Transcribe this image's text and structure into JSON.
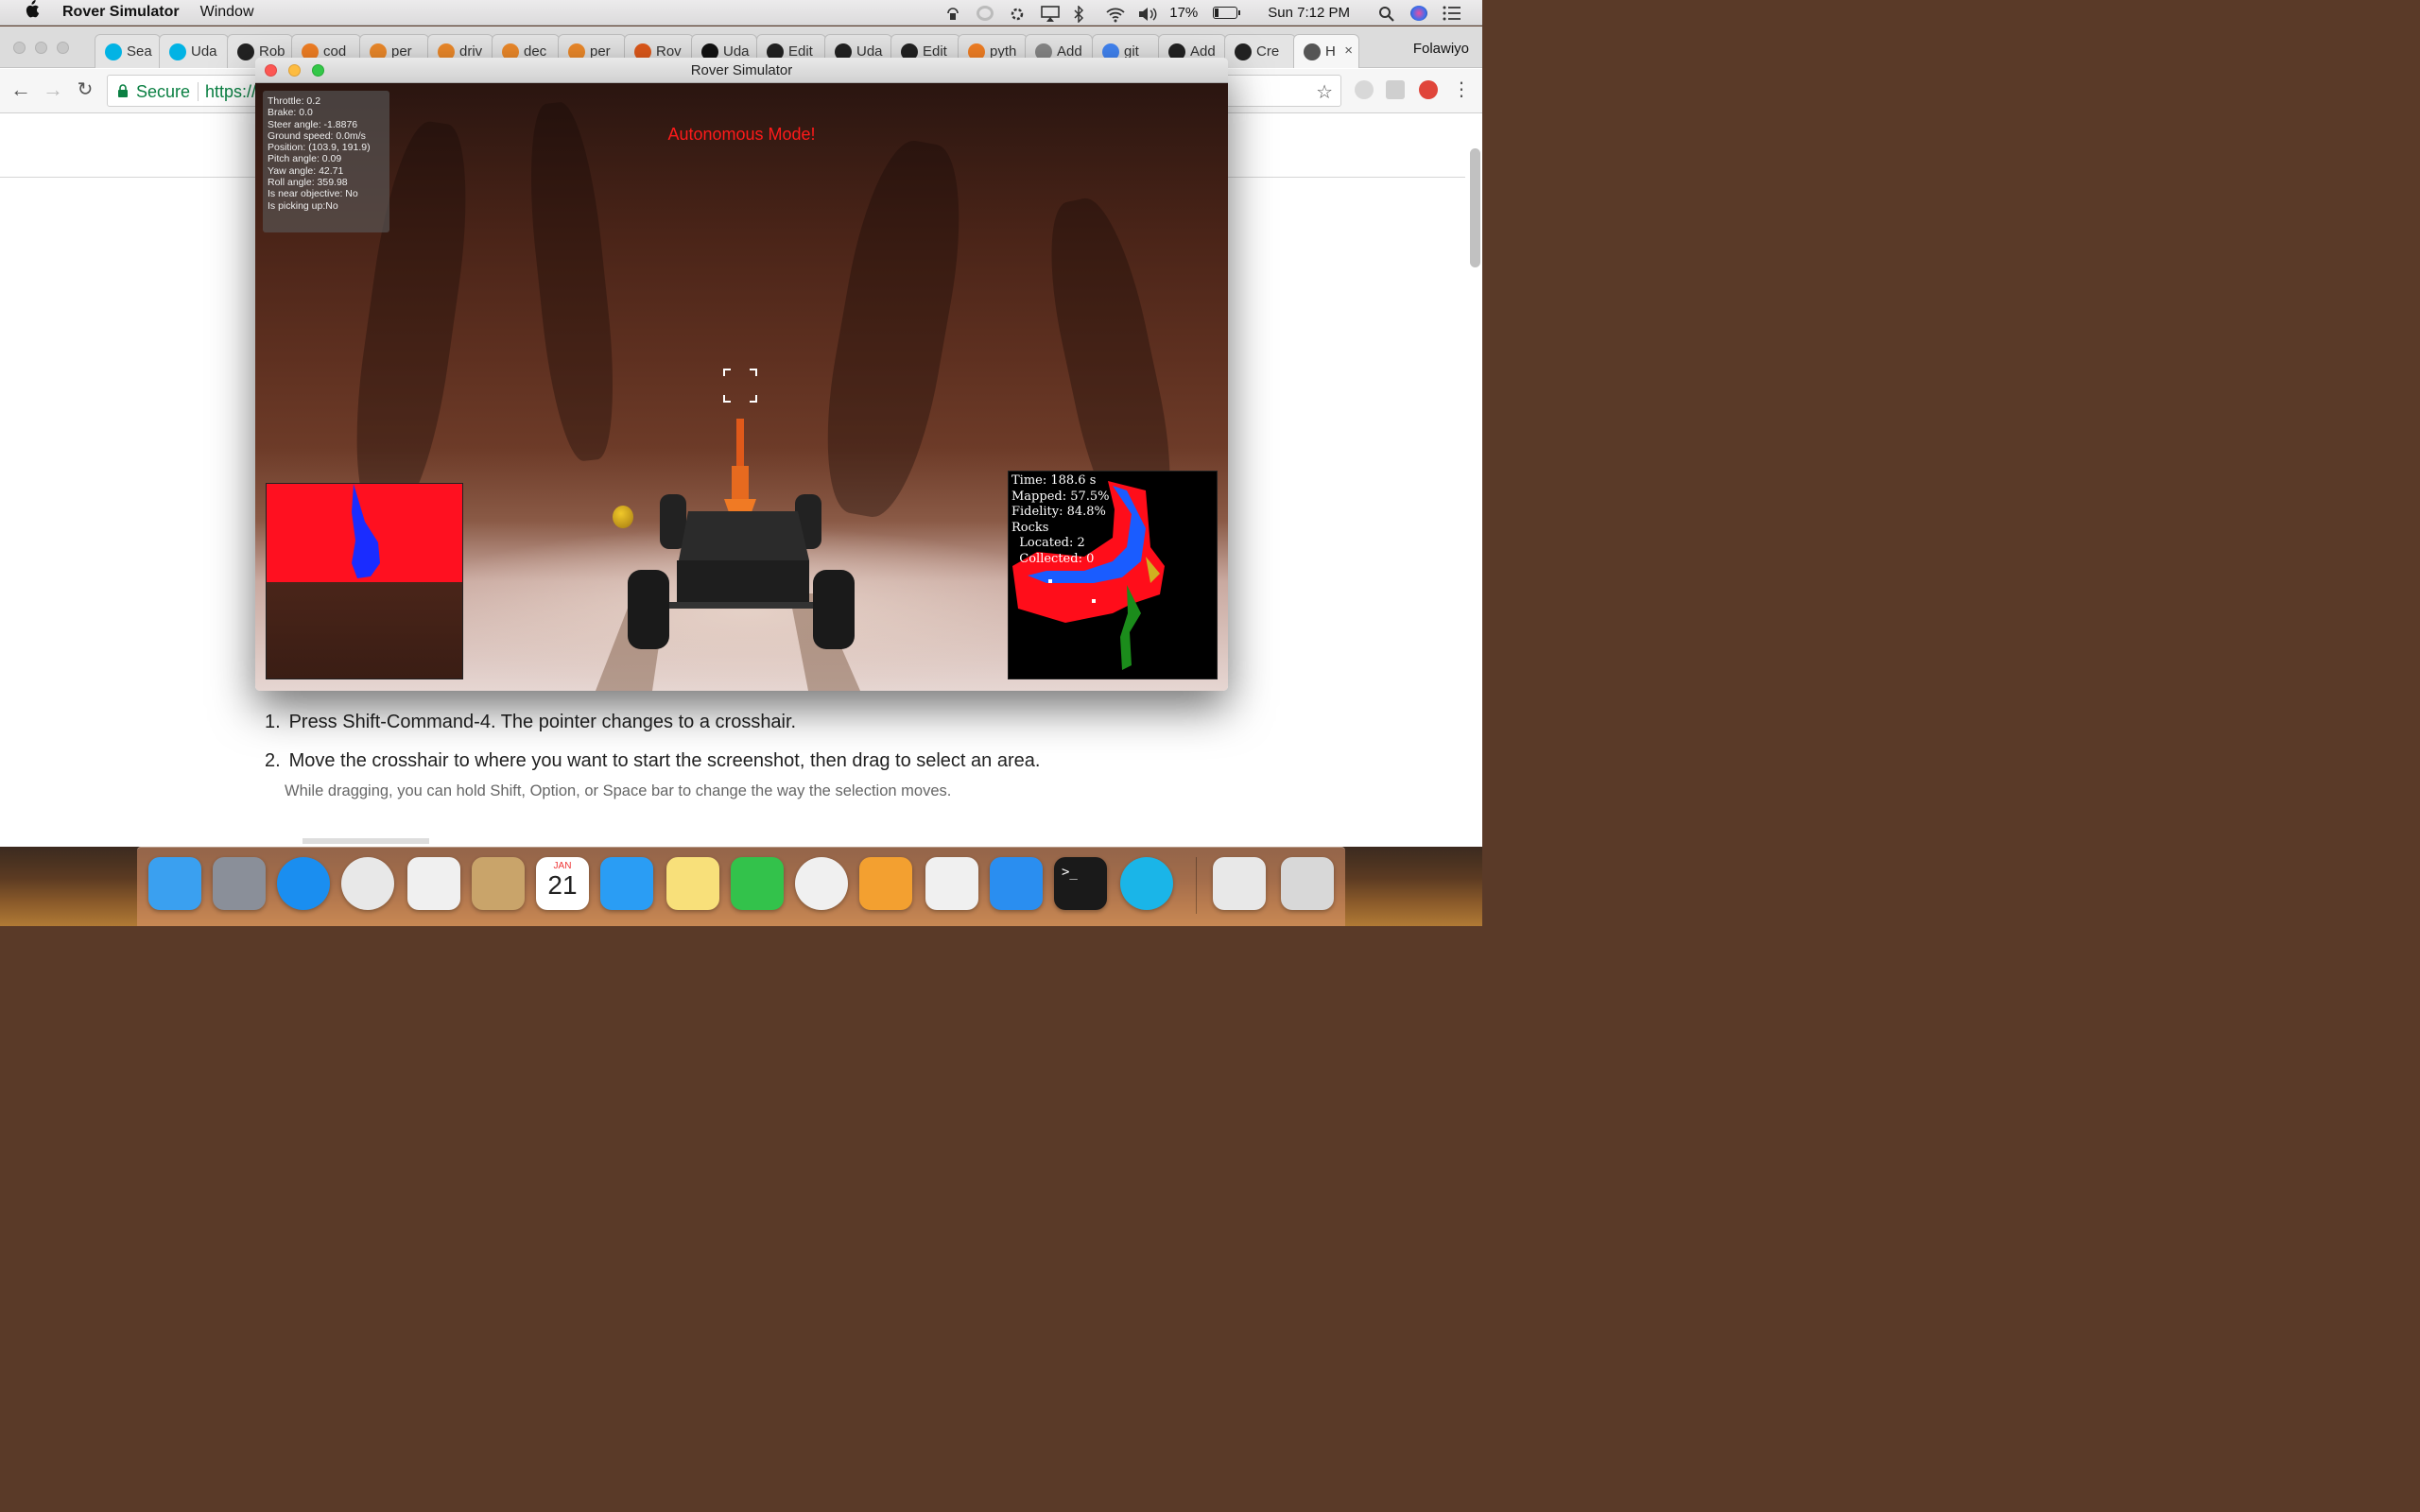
{
  "menubar": {
    "app_name": "Rover Simulator",
    "menus": [
      "Window"
    ],
    "battery": "17%",
    "clock": "Sun 7:12 PM"
  },
  "browser": {
    "tabs": [
      {
        "label": "Sea",
        "icon": "udacity-icon",
        "color": "#02b3e4"
      },
      {
        "label": "Uda",
        "icon": "udacity-icon",
        "color": "#02b3e4"
      },
      {
        "label": "Rob",
        "icon": "github-icon",
        "color": "#222222"
      },
      {
        "label": "cod",
        "icon": "spinner-icon",
        "color": "#f48024"
      },
      {
        "label": "per",
        "icon": "document-icon",
        "color": "#ee8a2a"
      },
      {
        "label": "driv",
        "icon": "document-icon",
        "color": "#ee8a2a"
      },
      {
        "label": "dec",
        "icon": "document-icon",
        "color": "#ee8a2a"
      },
      {
        "label": "per",
        "icon": "document-icon",
        "color": "#ee8a2a"
      },
      {
        "label": "Rov",
        "icon": "book-icon",
        "color": "#e0591a"
      },
      {
        "label": "Uda",
        "icon": "medium-icon",
        "color": "#111111"
      },
      {
        "label": "Edit",
        "icon": "github-icon",
        "color": "#222222"
      },
      {
        "label": "Uda",
        "icon": "github-icon",
        "color": "#222222"
      },
      {
        "label": "Edit",
        "icon": "github-icon",
        "color": "#222222"
      },
      {
        "label": "pyth",
        "icon": "stackoverflow-icon",
        "color": "#f48024"
      },
      {
        "label": "Add",
        "icon": "document-icon",
        "color": "#888888"
      },
      {
        "label": "git",
        "icon": "google-icon",
        "color": "#4285f4"
      },
      {
        "label": "Add",
        "icon": "github-icon",
        "color": "#222222"
      },
      {
        "label": "Cre",
        "icon": "github-icon",
        "color": "#222222"
      },
      {
        "label": "H",
        "icon": "apple-icon",
        "color": "#555555"
      }
    ],
    "profile_name": "Folawiyo",
    "secure_label": "Secure",
    "url": "https://"
  },
  "rover": {
    "window_title": "Rover Simulator",
    "mode_banner": "Autonomous Mode!",
    "telemetry": [
      "Throttle: 0.2",
      "Brake: 0.0",
      "Steer angle: -1.8876",
      "Ground speed: 0.0m/s",
      "Position: (103.9, 191.9)",
      "Pitch angle: 0.09",
      "Yaw angle: 42.71",
      "Roll angle: 359.98",
      "Is near objective: No",
      "Is picking up:No"
    ],
    "map_stats": [
      "Time: 188.6 s",
      "Mapped: 57.5%",
      "Fidelity: 84.8%",
      "Rocks",
      "  Located: 2",
      "  Collected: 0"
    ]
  },
  "page": {
    "steps": [
      {
        "num": "1.",
        "text": "Press Shift-Command-4. The pointer changes to a crosshair."
      },
      {
        "num": "2.",
        "text": "Move the crosshair to where you want to start the screenshot, then drag to select an area."
      }
    ],
    "note": "While dragging, you can hold Shift, Option, or Space bar to change the way the selection moves."
  },
  "dock": {
    "calendar_month": "JAN",
    "calendar_day": "21",
    "apps": [
      "Finder",
      "Launchpad",
      "Safari",
      "Chrome",
      "Apps",
      "Contacts",
      "Calendar",
      "Messages",
      "Notes",
      "FaceTime",
      "Photos",
      "Pages",
      "Numbers",
      "App Store",
      "Terminal",
      "Udacity",
      "Preview",
      "Trash"
    ]
  }
}
